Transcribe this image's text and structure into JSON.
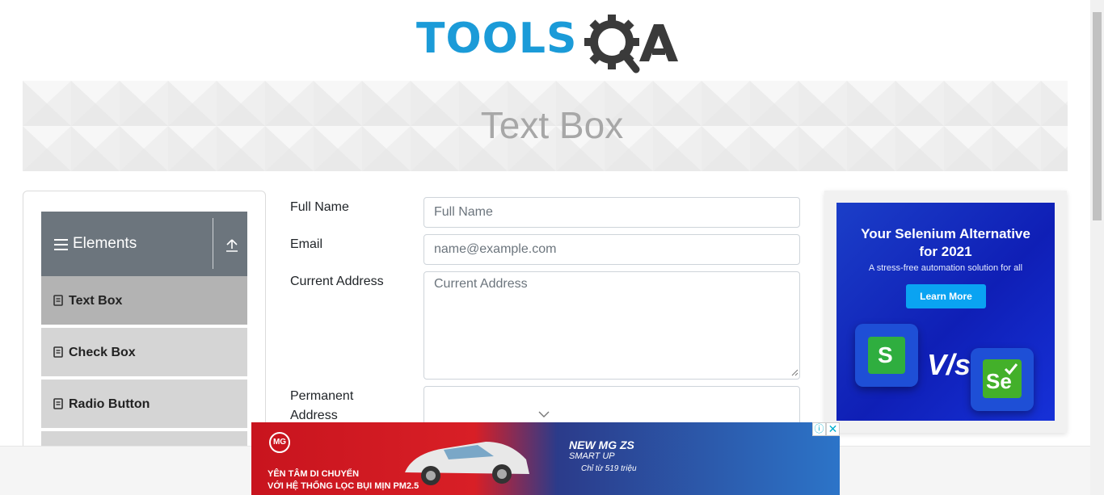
{
  "header": {
    "logo_text": "TOOLS",
    "logo_suffix": "QA"
  },
  "banner": {
    "title": "Text Box"
  },
  "sidebar": {
    "group": {
      "title": "Elements",
      "icon": "hamburger-icon",
      "toggle_icon": "upload-arrow-icon"
    },
    "items": [
      {
        "label": "Text Box",
        "icon": "document-icon",
        "active": true
      },
      {
        "label": "Check Box",
        "icon": "document-icon",
        "active": false
      },
      {
        "label": "Radio Button",
        "icon": "document-icon",
        "active": false
      }
    ]
  },
  "form": {
    "full_name": {
      "label": "Full Name",
      "placeholder": "Full Name",
      "value": ""
    },
    "email": {
      "label": "Email",
      "placeholder": "name@example.com",
      "value": ""
    },
    "current_address": {
      "label": "Current Address",
      "placeholder": "Current Address",
      "value": ""
    },
    "permanent_address": {
      "label_line1": "Permanent",
      "label_line2": "Address",
      "value": ""
    }
  },
  "right_ad": {
    "headline_line1": "Your Selenium Alternative",
    "headline_line2": "for 2021",
    "subtext": "A stress-free automation solution for all",
    "cta": "Learn More",
    "versus": "V/s",
    "left_tile_letter": "S",
    "right_tile_letters": "Se",
    "colors": {
      "background": "#1533c4",
      "cta": "#0aa3f2",
      "left_tile": "#2fae3f",
      "right_tile": "#43b02a"
    }
  },
  "bottom_ad": {
    "brand": "MG",
    "tagline_line1": "YÊN TÂM DI CHUYỂN",
    "tagline_line2": "VỚI HỆ THỐNG LỌC BỤI MỊN PM2.5",
    "model_line1": "NEW MG ZS",
    "model_line2": "SMART UP",
    "price": "Chỉ từ 519 triệu",
    "info_icon": "info-icon",
    "close_icon": "close-icon"
  }
}
